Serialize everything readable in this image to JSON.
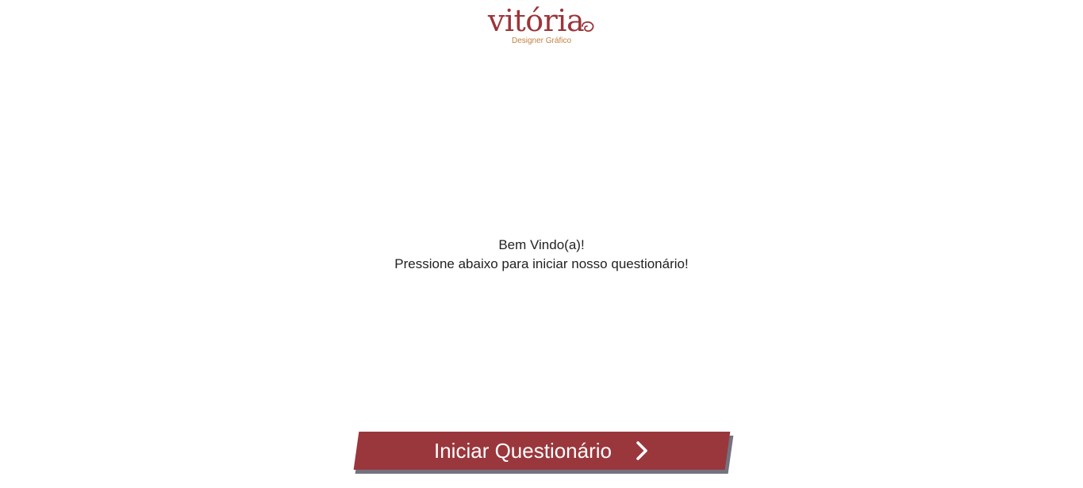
{
  "brand": {
    "name": "vitória",
    "tagline": "Designer Gráfico",
    "primary_color": "#9b353a",
    "accent_color": "#c0813f"
  },
  "welcome": {
    "greeting": "Bem Vindo(a)!",
    "instruction": "Pressione abaixo para iniciar nosso questionário!"
  },
  "cta": {
    "label": "Iniciar Questionário",
    "icon": "chevron-right-icon",
    "color": "#9a373c",
    "shadow_color": "#73727f"
  }
}
